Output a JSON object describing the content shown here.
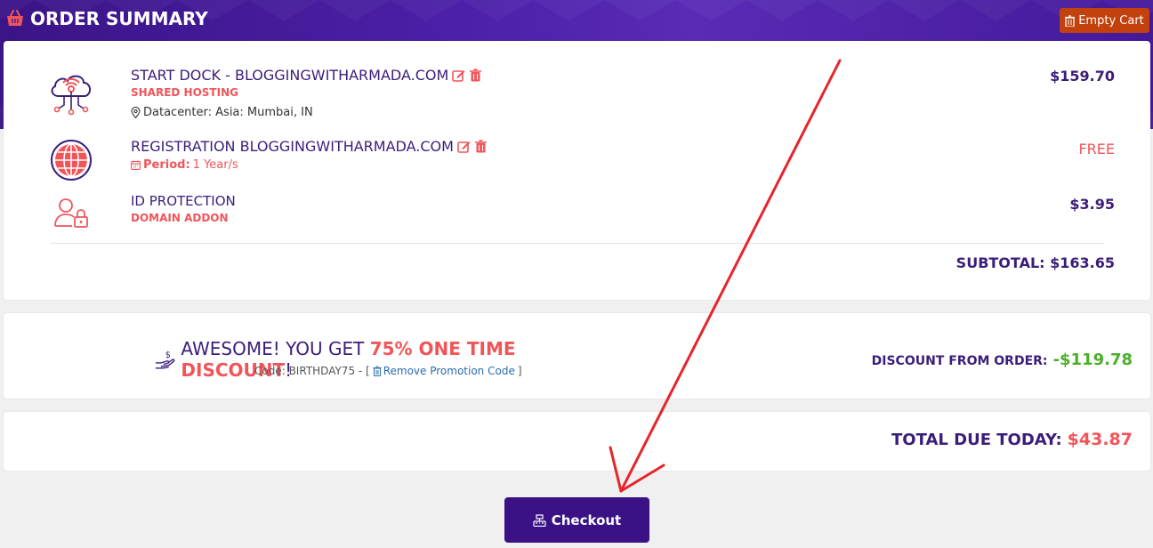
{
  "header": {
    "title": "ORDER SUMMARY",
    "icon": "basket-icon",
    "empty_cart_label": "Empty Cart"
  },
  "items": [
    {
      "icon": "cloud-network-icon",
      "name": "START DOCK - BLOGGINGWITHARMADA.COM",
      "type": "SHARED HOSTING",
      "meta": "Datacenter: Asia: Mumbai, IN",
      "price": "$159.70",
      "editable": true
    },
    {
      "icon": "globe-icon",
      "name": "REGISTRATION BLOGGINGWITHARMADA.COM",
      "period_label": "Period:",
      "period_value": "1 Year/s",
      "price": "FREE",
      "editable": true
    },
    {
      "icon": "user-lock-icon",
      "name": "ID PROTECTION",
      "type": "DOMAIN ADDON",
      "price": "$3.95",
      "editable": false
    }
  ],
  "subtotal": "SUBTOTAL: $163.65",
  "promo": {
    "text_before": "AWESOME! YOU GET ",
    "highlight": "75% ONE TIME DISCOUNT",
    "text_after": "!",
    "code_text": "Code: BIRTHDAY75 - [",
    "remove_label": "Remove Promotion Code",
    "code_close": "]",
    "discount_label": "DISCOUNT FROM ORDER:",
    "discount_value": "-$119.78"
  },
  "total": {
    "label": "TOTAL DUE TODAY:",
    "value": "$43.87"
  },
  "checkout_label": "Checkout",
  "colors": {
    "brand_purple": "#3a1285",
    "accent_red": "#f0555a",
    "discount_green": "#4caf28",
    "empty_cart_orange": "#c2410c",
    "annotation_arrow": "#e8242b"
  }
}
